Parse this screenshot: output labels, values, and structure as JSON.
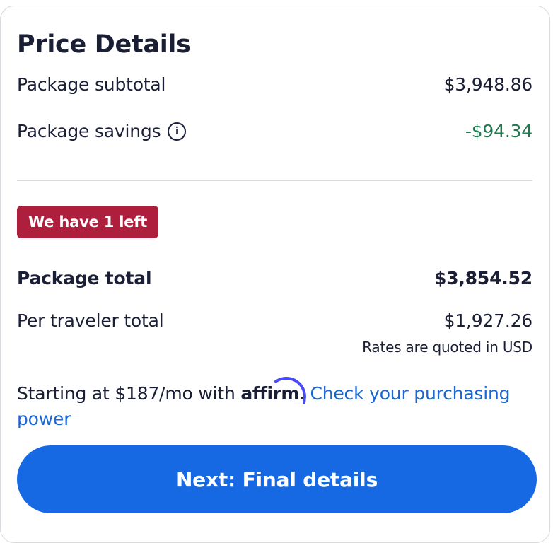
{
  "title": "Price Details",
  "subtotal": {
    "label": "Package subtotal",
    "value": "$3,948.86"
  },
  "savings": {
    "label": "Package savings",
    "value": "-$94.34",
    "info_icon": "info-icon",
    "color": "#227950"
  },
  "badge": {
    "text": "We have 1 left",
    "color": "#ad1f3c"
  },
  "total": {
    "label": "Package total",
    "value": "$3,854.52"
  },
  "per_traveler": {
    "label": "Per traveler total",
    "value": "$1,927.26"
  },
  "rates_note": "Rates are quoted in USD",
  "financing": {
    "prefix": "Starting at $187/mo with",
    "brand": "affirm",
    "period": ".",
    "link_text": "Check your purchasing power",
    "link_color": "#1a66d4"
  },
  "cta": {
    "label": "Next: Final details",
    "color": "#1668e3"
  }
}
